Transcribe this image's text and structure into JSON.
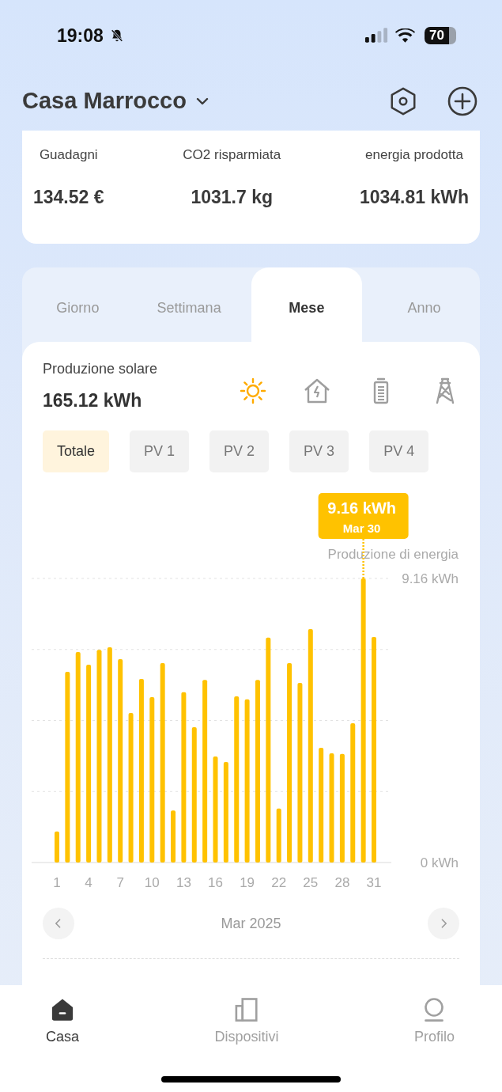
{
  "status_bar": {
    "time": "19:08",
    "battery": "70"
  },
  "header": {
    "title": "Casa Marrocco"
  },
  "stats": [
    {
      "label": "Guadagni",
      "value": "134.52 €"
    },
    {
      "label": "CO2 risparmiata",
      "value": "1031.7 kg"
    },
    {
      "label": "energia prodotta",
      "value": "1034.81 kWh"
    }
  ],
  "tabs": [
    {
      "label": "Giorno",
      "selected": false
    },
    {
      "label": "Settimana",
      "selected": false
    },
    {
      "label": "Mese",
      "selected": true
    },
    {
      "label": "Anno",
      "selected": false
    }
  ],
  "summary": {
    "label": "Produzione solare",
    "value": "165.12 kWh"
  },
  "sources": [
    {
      "kind": "sun",
      "selected": true
    },
    {
      "kind": "home",
      "selected": false
    },
    {
      "kind": "battery",
      "selected": false
    },
    {
      "kind": "grid",
      "selected": false
    }
  ],
  "filters": [
    {
      "label": "Totale",
      "selected": true
    },
    {
      "label": "PV 1",
      "selected": false
    },
    {
      "label": "PV 2",
      "selected": false
    },
    {
      "label": "PV 3",
      "selected": false
    },
    {
      "label": "PV 4",
      "selected": false
    }
  ],
  "chart": {
    "tooltip": {
      "value": "9.16 kWh",
      "date": "Mar 30"
    },
    "chart_data": {
      "type": "bar",
      "x": [
        1,
        2,
        3,
        4,
        5,
        6,
        7,
        8,
        9,
        10,
        11,
        12,
        13,
        14,
        15,
        16,
        17,
        18,
        19,
        20,
        21,
        22,
        23,
        24,
        25,
        26,
        27,
        28,
        29,
        30,
        31
      ],
      "series": [
        {
          "name": "Produzione di energia",
          "color": "#ffc200",
          "values": [
            1.0,
            6.15,
            6.79,
            6.38,
            6.86,
            6.94,
            6.56,
            4.82,
            5.92,
            5.33,
            6.43,
            1.68,
            5.49,
            4.36,
            5.89,
            3.42,
            3.24,
            5.36,
            5.26,
            5.89,
            7.25,
            1.74,
            6.43,
            5.79,
            7.53,
            3.7,
            3.52,
            3.5,
            4.49,
            9.16,
            7.27
          ]
        }
      ],
      "xticks": [
        1,
        4,
        7,
        10,
        13,
        16,
        19,
        22,
        25,
        28,
        31
      ],
      "xlim": [
        1,
        31
      ],
      "yticks": [
        {
          "value": 0,
          "label": "0 kWh"
        },
        {
          "value": 9.16,
          "label": "9.16 kWh"
        }
      ],
      "ylim": [
        0,
        9.16
      ]
    }
  },
  "period": {
    "label": "Mar 2025"
  },
  "nav": [
    {
      "label": "Casa",
      "kind": "home",
      "selected": true
    },
    {
      "label": "Dispositivi",
      "kind": "devices",
      "selected": false
    },
    {
      "label": "Profilo",
      "kind": "profile",
      "selected": false
    }
  ]
}
